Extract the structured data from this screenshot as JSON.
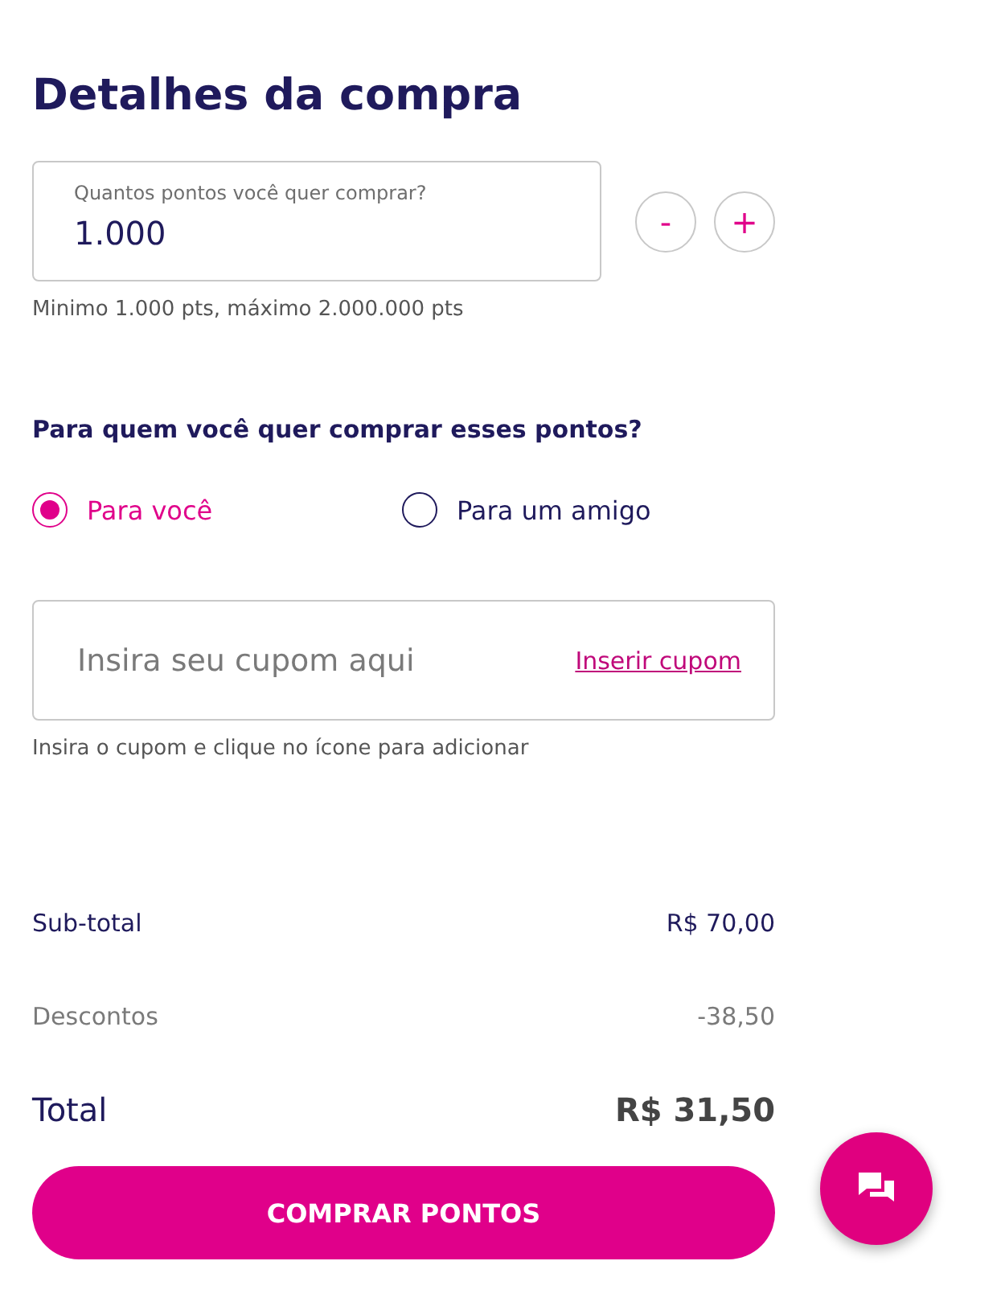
{
  "title": "Detalhes da compra",
  "points_field": {
    "label": "Quantos pontos você quer comprar?",
    "value": "1.000"
  },
  "stepper": {
    "decrement": "-",
    "increment": "+"
  },
  "points_hint": "Minimo 1.000 pts, máximo 2.000.000 pts",
  "recipient_question": "Para quem você quer comprar esses pontos?",
  "recipients": [
    {
      "label": "Para você",
      "selected": true
    },
    {
      "label": "Para um amigo",
      "selected": false
    }
  ],
  "coupon": {
    "placeholder": "Insira seu cupom aqui",
    "link": "Inserir cupom",
    "hint": "Insira o cupom e clique no ícone para adicionar"
  },
  "summary": [
    {
      "kind": "regular",
      "label": "Sub-total",
      "value": "R$ 70,00"
    },
    {
      "kind": "muted",
      "label": "Descontos",
      "value": "-38,50"
    },
    {
      "kind": "total",
      "label": "Total",
      "value": "R$ 31,50"
    }
  ],
  "buy_button": "COMPRAR PONTOS"
}
